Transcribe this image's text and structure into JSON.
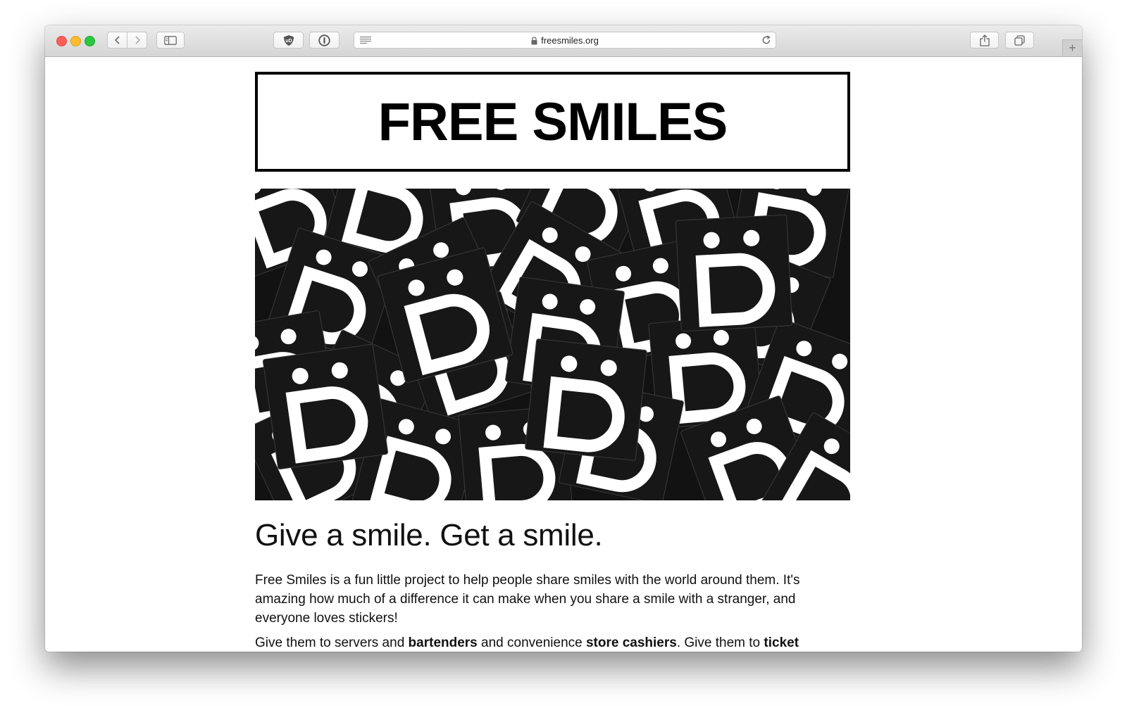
{
  "browser": {
    "url": "freesmiles.org",
    "new_tab_symbol": "+",
    "icons": [
      "back-icon",
      "forward-icon",
      "sidebar-icon",
      "shield-icon",
      "password-icon",
      "reader-icon",
      "lock-icon",
      "reload-icon",
      "share-icon",
      "tabs-icon"
    ]
  },
  "site": {
    "title": "FREE SMILES",
    "hero_image": "black smiley face stickers with white D-shaped smile and two dots, scattered in a pile"
  },
  "article": {
    "headline": "Give a smile. Get a smile.",
    "intro": "Free Smiles is a fun little project to help people share smiles with the world around them. It's amazing how much of a difference it can make when you share a smile with a stranger, and everyone loves stickers!",
    "para2_a": "Give them to servers and ",
    "para2_b": "bartenders",
    "para2_c": " and convenience ",
    "para2_d": "store cashiers",
    "para2_e": ". Give them to ",
    "para2_f": "ticket"
  },
  "colors": {
    "title_border": "#000000",
    "sticker_black": "#161616",
    "sticker_white": "#ffffff"
  }
}
